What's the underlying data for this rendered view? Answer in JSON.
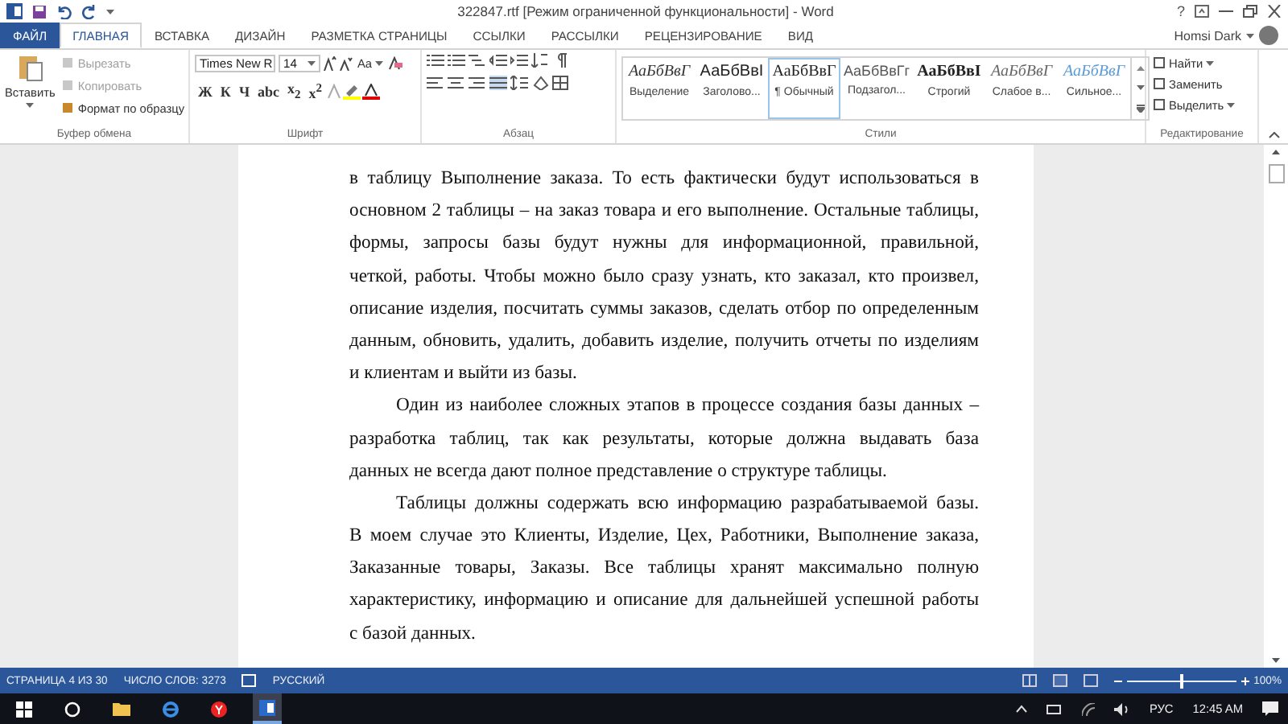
{
  "window": {
    "title": "322847.rtf [Режим ограниченной функциональности] - Word",
    "help": "?",
    "user": "Homsi Dark"
  },
  "tabs": [
    {
      "label": "ФАЙЛ",
      "kind": "file",
      "selected": false
    },
    {
      "label": "ГЛАВНАЯ",
      "kind": "tab",
      "selected": true
    },
    {
      "label": "ВСТАВКА",
      "kind": "tab",
      "selected": false
    },
    {
      "label": "ДИЗАЙН",
      "kind": "tab",
      "selected": false
    },
    {
      "label": "РАЗМЕТКА СТРАНИЦЫ",
      "kind": "tab",
      "selected": false
    },
    {
      "label": "ССЫЛКИ",
      "kind": "tab",
      "selected": false
    },
    {
      "label": "РАССЫЛКИ",
      "kind": "tab",
      "selected": false
    },
    {
      "label": "РЕЦЕНЗИРОВАНИЕ",
      "kind": "tab",
      "selected": false
    },
    {
      "label": "ВИД",
      "kind": "tab",
      "selected": false
    }
  ],
  "clipboard": {
    "label": "Буфер обмена",
    "paste": "Вставить",
    "actions": [
      {
        "label": "Вырезать",
        "disabled": true
      },
      {
        "label": "Копировать",
        "disabled": true
      },
      {
        "label": "Формат по образцу",
        "disabled": false
      }
    ]
  },
  "font": {
    "label": "Шрифт",
    "name": "Times New R",
    "size": "14",
    "change_case": "Aa",
    "buttons": [
      "Ж",
      "К",
      "Ч",
      "abc",
      "x$_{2}$",
      "x$^{2}$"
    ]
  },
  "paragraph": {
    "label": "Абзац"
  },
  "styles": {
    "label": "Стили",
    "items": [
      {
        "preview": "АаБбВвГ",
        "name": "Выделение",
        "kind": "emphasis",
        "selected": false
      },
      {
        "preview": "АаБбВвІ",
        "name": "Заголово...",
        "kind": "heading",
        "selected": false
      },
      {
        "preview": "АаБбВвГ",
        "name": "¶ Обычный",
        "kind": "normal",
        "selected": true
      },
      {
        "preview": "АаБбВвГг",
        "name": "Подзагол...",
        "kind": "subtitle",
        "selected": false
      },
      {
        "preview": "АаБбВвІ",
        "name": "Строгий",
        "kind": "strong",
        "selected": false
      },
      {
        "preview": "АаБбВвГ",
        "name": "Слабое в...",
        "kind": "subtle",
        "selected": false
      },
      {
        "preview": "АаБбВвГ",
        "name": "Сильное...",
        "kind": "intense",
        "selected": false
      }
    ]
  },
  "editing": {
    "label": "Редактирование",
    "actions": [
      "Найти",
      "Заменить",
      "Выделить"
    ]
  },
  "document": {
    "paragraphs": [
      {
        "indented": false,
        "lines": [
          "в таблицу Выполнение заказа. То есть фактически будут использоваться в",
          "основном 2 таблицы – на заказ товара и его выполнение. Остальные таблицы,",
          "формы, запросы базы будут нужны для информационной, правильной,",
          "четкой, работы. Чтобы можно было сразу узнать, кто заказал, кто произвел,",
          "описание изделия, посчитать суммы заказов, сделать отбор по определенным",
          "данным, обновить, удалить, добавить изделие, получить отчеты по изделиям",
          "и клиентам и выйти из базы."
        ]
      },
      {
        "indented": true,
        "lines": [
          "Один из наиболее сложных этапов в процессе создания базы данных –",
          "разработка таблиц, так как результаты, которые должна выдавать база",
          "данных не всегда дают полное представление о структуре таблицы."
        ]
      },
      {
        "indented": true,
        "lines": [
          "Таблицы должны содержать всю информацию разрабатываемой базы.",
          "В моем случае это Клиенты, Изделие, Цех, Работники, Выполнение заказа,",
          "Заказанные товары, Заказы. Все таблицы хранят максимально полную",
          "характеристику, информацию и описание для дальнейшей успешной работы",
          "с базой данных."
        ]
      }
    ]
  },
  "status_bar": {
    "items": [
      "СТРАНИЦА 4 ИЗ 30",
      "ЧИСЛО СЛОВ: 3273",
      "РУССКИЙ"
    ],
    "zoom": {
      "level": 0.5,
      "reading": "100%"
    }
  },
  "taskbar": {
    "language": "РУС",
    "time": "12:45 AM"
  }
}
